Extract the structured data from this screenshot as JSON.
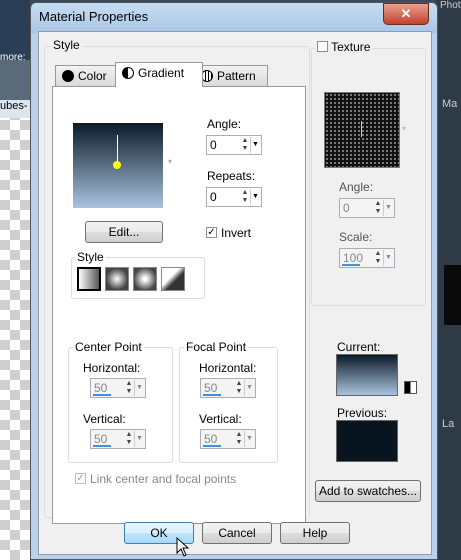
{
  "background": {
    "top_label": "more:",
    "tab_label": "ubes-",
    "right_top": "Phot",
    "right_ma": "Ma",
    "right_la": "La"
  },
  "dialog": {
    "title": "Material Properties",
    "close_glyph": "✕",
    "style_group_label": "Style",
    "tabs": [
      "Color",
      "Gradient",
      "Pattern"
    ],
    "active_tab": "Gradient",
    "angle_label": "Angle:",
    "angle_value": "0",
    "repeats_label": "Repeats:",
    "repeats_value": "0",
    "edit_button": "Edit...",
    "invert_label": "Invert",
    "invert_checked": true,
    "inner_style_label": "Style",
    "center_point_label": "Center Point",
    "focal_point_label": "Focal Point",
    "horizontal_label": "Horizontal:",
    "vertical_label": "Vertical:",
    "center_h": "50",
    "center_v": "50",
    "focal_h": "50",
    "focal_v": "50",
    "link_label": "Link center and focal points",
    "texture_label": "Texture",
    "texture_angle_label": "Angle:",
    "texture_angle_value": "0",
    "scale_label": "Scale:",
    "scale_value": "100",
    "current_label": "Current:",
    "previous_label": "Previous:",
    "add_swatches_button": "Add to swatches...",
    "ok_button": "OK",
    "cancel_button": "Cancel",
    "help_button": "Help",
    "colors": {
      "gradient_top": "#0c1a28",
      "gradient_bottom": "#a9c3de",
      "previous": "#08141f",
      "marker": "#ffff00"
    }
  }
}
